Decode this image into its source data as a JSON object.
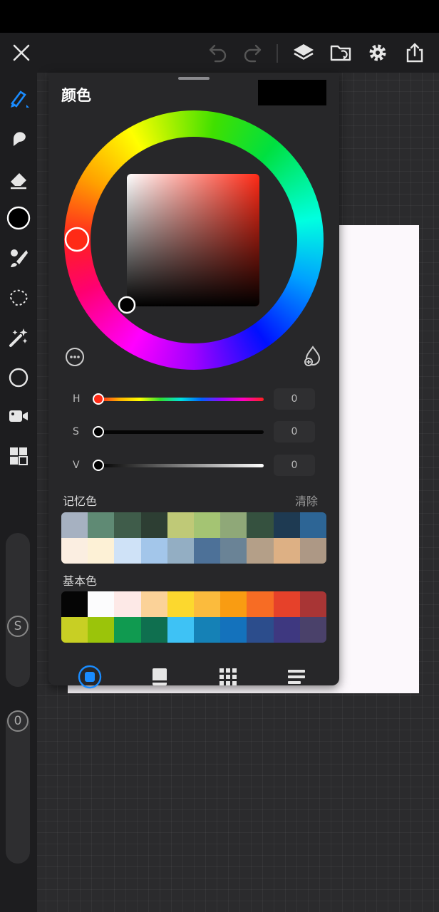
{
  "panel": {
    "title": "颜色",
    "hsv": {
      "h_label": "H",
      "h_value": "0",
      "s_label": "S",
      "s_value": "0",
      "v_label": "V",
      "v_value": "0"
    },
    "history_label": "记忆色",
    "clear_label": "清除",
    "default_label": "基本色",
    "history_colors": [
      "#a6b1c1",
      "#5f8a74",
      "#3f5c4a",
      "#2d3e33",
      "#bfc977",
      "#a4c473",
      "#8fa878",
      "#35513f",
      "#1e3a52",
      "#2d6595",
      "#fbeee1",
      "#fdf1d6",
      "#cfe2f7",
      "#a3c6ea",
      "#93aec3",
      "#4d7198",
      "#6a8396",
      "#b49f88",
      "#ddb084",
      "#ad9885"
    ],
    "default_colors": [
      "#050505",
      "#fcfcfd",
      "#fde9e7",
      "#fbd298",
      "#fcd82e",
      "#fbbb3d",
      "#f99c12",
      "#f76c24",
      "#e6412a",
      "#a83535",
      "#c8cf24",
      "#9bc40a",
      "#109a50",
      "#0f6f4f",
      "#3ec2f5",
      "#1581b6",
      "#1472bc",
      "#2c4d8c",
      "#3e3880",
      "#4a416a"
    ],
    "colors": {
      "accent": "#1a8cff",
      "current": "#000000",
      "previous": "#000000"
    }
  },
  "icons": {
    "top": [
      "close-icon",
      "undo-icon",
      "redo-icon",
      "layers-icon",
      "import-icon",
      "settings-icon",
      "share-icon"
    ],
    "side": [
      "brush-icon",
      "smudge-icon",
      "eraser-icon",
      "color-icon",
      "brush-library-icon",
      "selection-icon",
      "adjustments-icon",
      "shape-icon",
      "video-icon",
      "gallery-icon"
    ]
  },
  "side_sliders": {
    "size_label": "S",
    "opacity_label": "0"
  }
}
